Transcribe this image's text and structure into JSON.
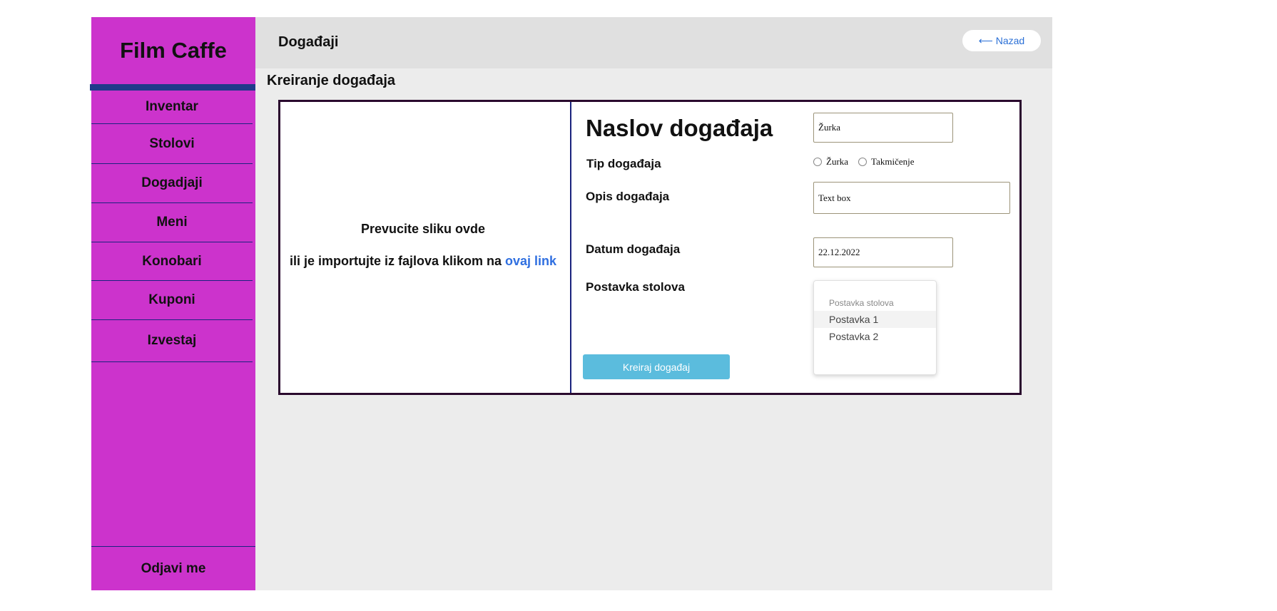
{
  "sidebar": {
    "brand": "Film Caffe",
    "items": [
      {
        "label": "Inventar"
      },
      {
        "label": "Stolovi"
      },
      {
        "label": "Dogadjaji"
      },
      {
        "label": "Meni"
      },
      {
        "label": "Konobari"
      },
      {
        "label": "Kuponi"
      },
      {
        "label": "Izvestaj"
      }
    ],
    "logout_label": "Odjavi me"
  },
  "header": {
    "title": "Događaji",
    "back_label": "⟵ Nazad"
  },
  "page_title": "Kreiranje događaja",
  "dropzone": {
    "line1": "Prevucite sliku ovde",
    "line2": "ili je importujte iz fajlova klikom na ",
    "link": "ovaj link"
  },
  "form": {
    "title_label": "Naslov događaja",
    "title_value": "Žurka",
    "type_label": "Tip događaja",
    "type_options": [
      "Žurka",
      "Takmičenje"
    ],
    "desc_label": "Opis događaja",
    "desc_value": "Text box",
    "date_label": "Datum događaja",
    "date_value": "22.12.2022",
    "layout_label": "Postavka stolova",
    "layout_dropdown": {
      "header": "Postavka stolova",
      "options": [
        "Postavka 1",
        "Postavka 2"
      ],
      "highlighted": "Postavka 1"
    },
    "submit_label": "Kreiraj događaj"
  },
  "colors": {
    "sidebar": "#cc33cc",
    "brand_bar": "#1f3a8a",
    "submit": "#5bbcdd",
    "link": "#2f6fe0"
  }
}
